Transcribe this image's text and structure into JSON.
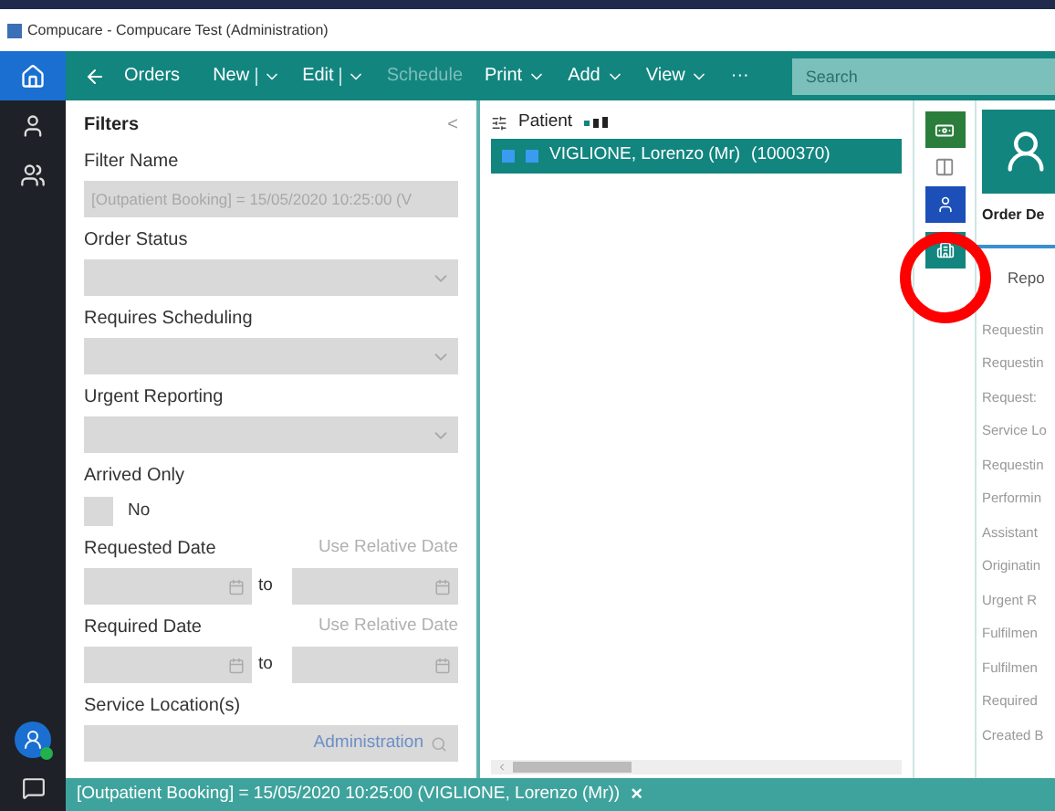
{
  "window": {
    "title": "Compucare - Compucare Test (Administration)"
  },
  "nav": {
    "items": [
      {
        "kind": "home",
        "selected": true
      },
      {
        "kind": "person",
        "selected": false
      },
      {
        "kind": "people",
        "selected": false
      }
    ],
    "user_online": true
  },
  "toolbar": {
    "title": "Orders",
    "items": [
      {
        "label": "New",
        "kind": "split",
        "disabled": false
      },
      {
        "label": "Edit",
        "kind": "split",
        "disabled": false
      },
      {
        "label": "Schedule",
        "kind": "plain",
        "disabled": true
      },
      {
        "label": "Print",
        "kind": "dropdown",
        "disabled": false
      },
      {
        "label": "Add",
        "kind": "dropdown",
        "disabled": false
      },
      {
        "label": "View",
        "kind": "dropdown",
        "disabled": false
      },
      {
        "label": "···",
        "kind": "plain",
        "disabled": false
      }
    ],
    "search": {
      "placeholder": "Search"
    }
  },
  "filters": {
    "title": "Filters",
    "collapse": "<",
    "fields": [
      {
        "kind": "text",
        "label": "Filter Name",
        "value": "[Outpatient Booking] = 15/05/2020 10:25:00 (V"
      },
      {
        "kind": "select",
        "label": "Order Status"
      },
      {
        "kind": "select",
        "label": "Requires Scheduling"
      },
      {
        "kind": "select",
        "label": "Urgent Reporting"
      },
      {
        "kind": "toggle",
        "label": "Arrived Only",
        "value": "No",
        "checked": false
      },
      {
        "kind": "daterange",
        "label": "Requested Date",
        "link": "Use Relative Date",
        "separator": "to"
      },
      {
        "kind": "daterange",
        "label": "Required Date",
        "link": "Use Relative Date",
        "separator": "to"
      },
      {
        "kind": "lookup",
        "label": "Service Location(s)",
        "value": "Administration"
      }
    ]
  },
  "patients": {
    "header": "Patient",
    "rows": [
      {
        "name": "VIGLIONE, Lorenzo (Mr)",
        "number": "(1000370)",
        "selected": true
      }
    ]
  },
  "detail": {
    "title": "Order De",
    "tab": "Repo",
    "labels": [
      "Requestin",
      "Requestin",
      "Request:",
      "Service Lo",
      "Requestin",
      "Performin",
      "Assistant",
      "Originatin",
      "Urgent R",
      "Fulfilmen",
      "Fulfilmen",
      "Required",
      "Created B"
    ]
  },
  "status_bar": {
    "text": "[Outpatient Booking] = 15/05/2020 10:25:00 (VIGLIONE, Lorenzo (Mr))",
    "close": "×"
  }
}
